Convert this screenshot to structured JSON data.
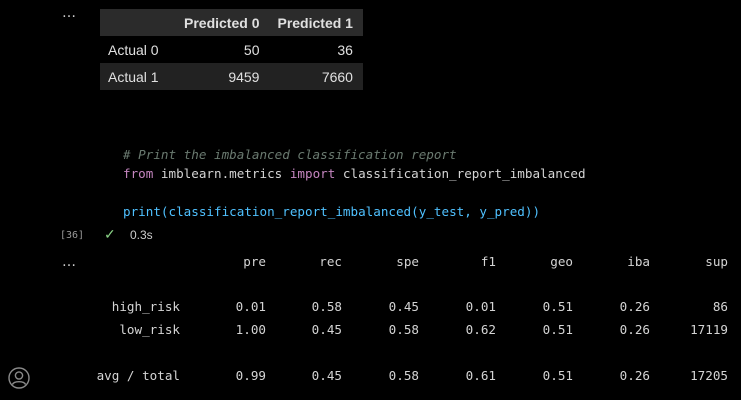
{
  "ellipsis": "…",
  "dataframe": {
    "columns": [
      "",
      "Predicted 0",
      "Predicted 1"
    ],
    "rows": [
      {
        "label": "Actual 0",
        "values": [
          "50",
          "36"
        ]
      },
      {
        "label": "Actual 1",
        "values": [
          "9459",
          "7660"
        ]
      }
    ]
  },
  "code_cell": {
    "comment": "# Print the imbalanced classification report",
    "line2": {
      "from": "from",
      "module": " imblearn.metrics ",
      "import": "import",
      "name": " classification_report_imbalanced"
    },
    "line4": {
      "print": "print",
      "open": "(",
      "func": "classification_report_imbalanced",
      "args": "(y_test, y_pred))"
    },
    "execution_count": "[36]",
    "duration": "0.3s"
  },
  "report": {
    "headers": [
      "pre",
      "rec",
      "spe",
      "f1",
      "geo",
      "iba",
      "sup"
    ],
    "rows": [
      {
        "name": "high_risk",
        "values": [
          "0.01",
          "0.58",
          "0.45",
          "0.01",
          "0.51",
          "0.26",
          "86"
        ]
      },
      {
        "name": "low_risk",
        "values": [
          "1.00",
          "0.45",
          "0.58",
          "0.62",
          "0.51",
          "0.26",
          "17119"
        ]
      },
      {
        "name": "avg / total",
        "values": [
          "0.99",
          "0.45",
          "0.58",
          "0.61",
          "0.51",
          "0.26",
          "17205"
        ]
      }
    ]
  },
  "icons": {
    "account": "account-icon",
    "check": "checkmark-icon"
  }
}
